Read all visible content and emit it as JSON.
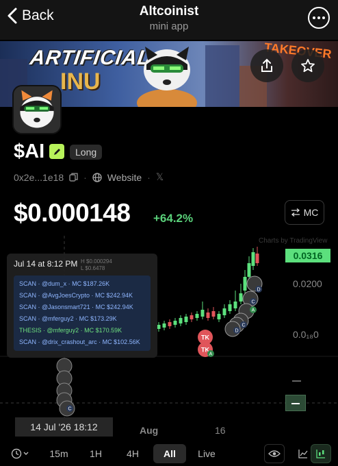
{
  "header": {
    "back_label": "Back",
    "title": "Altcoinist",
    "subtitle": "mini app"
  },
  "banner": {
    "logo_line1": "ARTIFICIAL",
    "logo_line2": "INU",
    "right_text": "TAKEOVER"
  },
  "token": {
    "ticker": "$AI",
    "position_badge": "Long",
    "address": "0x2e...1e18",
    "website_label": "Website",
    "x_label": "𝕏",
    "price": "$0.000148",
    "change": "+64.2%",
    "mc_toggle_label": "MC"
  },
  "chart": {
    "credit": "Charts by TradingView",
    "tooltip": {
      "time": "Jul 14 at 8:12 PM",
      "high": "H $0.000294",
      "low": "L $0.6478",
      "rows": [
        "SCAN · @dum_x · MC $187.26K",
        "SCAN · @AvgJoesCrypto · MC $242.94K",
        "SCAN · @Jasonsmart721 · MC $242.94K",
        "SCAN · @mferguy2 · MC $173.29K",
        "THESIS · @mferguy2 · MC $170.59K",
        "SCAN · @drix_crashout_arc · MC $102.56K"
      ]
    },
    "current_price_tag": "0.0316",
    "y_ticks": [
      "0.0200",
      "0.0₁₈0"
    ],
    "x_ticks": [
      "Aug",
      "16"
    ],
    "crosshair_date": "14 Jul '26   18:12",
    "bubble_letters": [
      "D",
      "C",
      "A",
      "C",
      "D",
      "A",
      "C"
    ],
    "bubble_tk_label": "TK",
    "colors": {
      "up": "#5ce07d",
      "down": "#e0555a",
      "tag_bg": "#5ce07d",
      "tooltip_bg": "#202020"
    }
  },
  "bottom_bar": {
    "timeframes": [
      "15m",
      "1H",
      "4H",
      "All",
      "Live"
    ],
    "active_timeframe": "All"
  }
}
